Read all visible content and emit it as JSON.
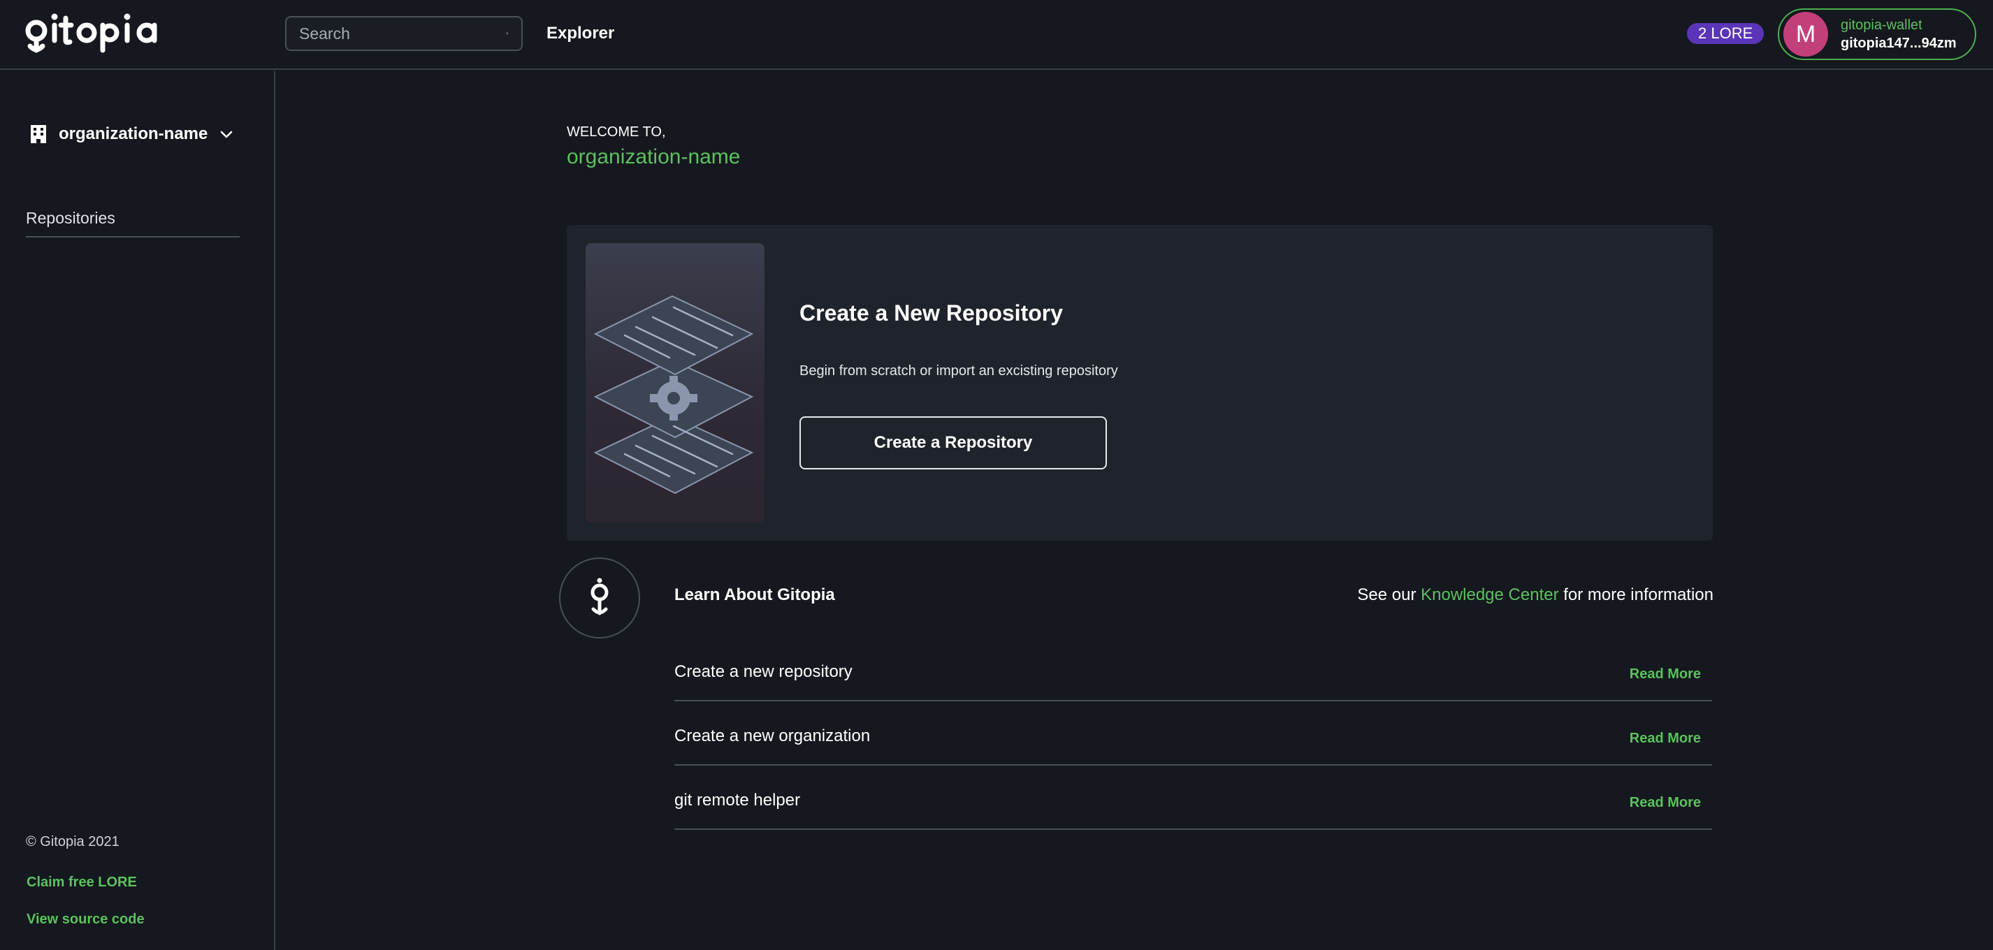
{
  "header": {
    "logo_text": "gitopia",
    "search_placeholder": "Search",
    "explorer_label": "Explorer",
    "lore_badge": "2 LORE",
    "wallet": {
      "avatar_letter": "M",
      "name": "gitopia-wallet",
      "address": "gitopia147...94zm"
    }
  },
  "sidebar": {
    "org_name": "organization-name",
    "repositories_label": "Repositories",
    "copyright": "© Gitopia 2021",
    "claim_lore": "Claim free LORE",
    "view_source": "View source code"
  },
  "main": {
    "welcome_label": "WELCOME TO,",
    "welcome_org": "organization-name",
    "create_card": {
      "title": "Create a New Repository",
      "subtitle": "Begin from scratch or import an excisting repository",
      "button_label": "Create a Repository"
    },
    "learn": {
      "title": "Learn About Gitopia",
      "prefix": "See our ",
      "link": "Knowledge Center",
      "suffix": " for more information",
      "articles": [
        {
          "title": "Create a new repository",
          "read_more": "Read More"
        },
        {
          "title": "Create a new organization",
          "read_more": "Read More"
        },
        {
          "title": "git remote helper",
          "read_more": "Read More"
        }
      ]
    }
  },
  "icons": {
    "search": "search-icon",
    "building": "building-icon",
    "chevron": "chevron-down-icon",
    "logo": "gitopia-logo-icon"
  },
  "colors": {
    "background": "#15181e",
    "card": "#1f232b",
    "accent_green": "#5cc15f",
    "lore_purple": "#5b35b8",
    "avatar_pink": "#c2407a"
  }
}
